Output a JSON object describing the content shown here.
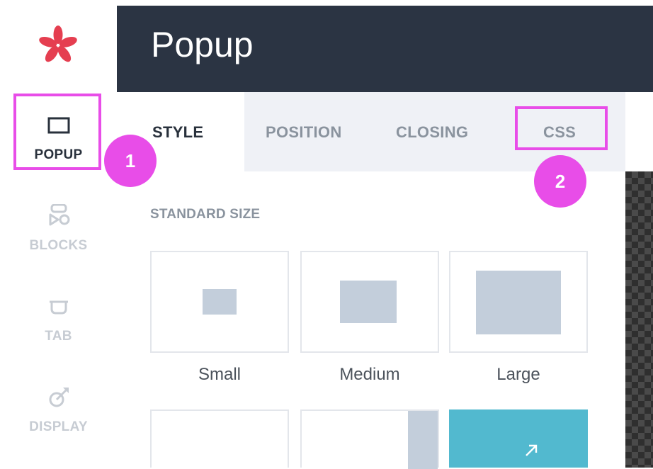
{
  "app": {
    "logo_icon": "asterisk-logo-icon",
    "brand_color": "#e53e50"
  },
  "sidebar": {
    "items": [
      {
        "label": "POPUP",
        "icon": "rectangle-icon",
        "active": true
      },
      {
        "label": "BLOCKS",
        "icon": "shapes-icon",
        "active": false
      },
      {
        "label": "TAB",
        "icon": "tab-icon",
        "active": false
      },
      {
        "label": "DISPLAY",
        "icon": "target-icon",
        "active": false
      }
    ]
  },
  "header": {
    "title": "Popup"
  },
  "tabs": [
    {
      "label": "STYLE",
      "active": true
    },
    {
      "label": "POSITION",
      "active": false
    },
    {
      "label": "CLOSING",
      "active": false
    },
    {
      "label": "CSS",
      "active": false
    }
  ],
  "annotations": {
    "badge_1": "1",
    "badge_2": "2",
    "highlight_color": "#e84de8"
  },
  "style_panel": {
    "section_title": "STANDARD SIZE",
    "sizes": [
      {
        "label": "Small"
      },
      {
        "label": "Medium"
      },
      {
        "label": "Large"
      }
    ],
    "expand_icon": "expand-arrow-icon"
  },
  "colors": {
    "header_bg": "#2b3443",
    "accent_teal": "#52b9cf",
    "shape_fill": "#c3cedb"
  }
}
